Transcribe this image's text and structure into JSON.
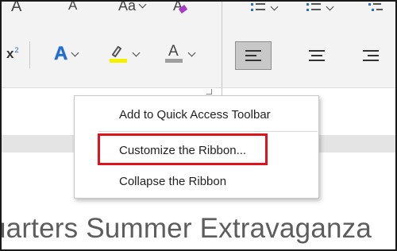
{
  "ribbon": {
    "font_row1": {
      "a1": "A",
      "a2": "A",
      "change_case": "Aa",
      "clear_format": "A"
    },
    "superscript": {
      "base": "x",
      "sup": "2"
    },
    "text_effects": "A",
    "font_color": "A",
    "colors": {
      "text_effects": "#1f6fd1",
      "highlight": "#f5f000",
      "font_color_bar": "#9e9e9e",
      "clear_format_eraser": "#a83ac8",
      "bullets": "#2b6cc4"
    },
    "alignment": [
      "align-left",
      "center",
      "align-right"
    ],
    "active_alignment": "align-left"
  },
  "context_menu": {
    "items": [
      {
        "label": "Add to Quick Access Toolbar"
      },
      {
        "label": "Customize the Ribbon..."
      },
      {
        "label": "Collapse the Ribbon"
      }
    ],
    "highlighted_item": "Customize the Ribbon..."
  },
  "document": {
    "visible_text": "uarters Summer Extravaganza"
  },
  "accent_colors": {
    "highlight_box": "#e0121b"
  }
}
